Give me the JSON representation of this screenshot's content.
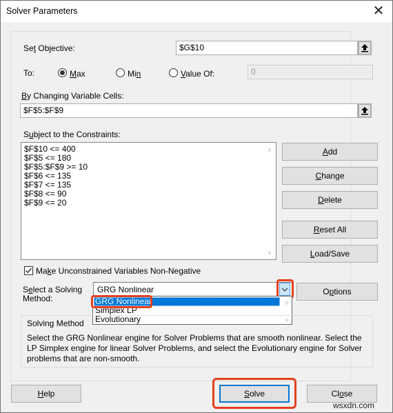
{
  "window": {
    "title": "Solver Parameters",
    "close_icon": "close-icon"
  },
  "objective": {
    "label_pre": "Se",
    "label_ul": "t",
    "label_post": " Objective:",
    "value": "$G$10"
  },
  "to": {
    "label": "To:",
    "options": [
      {
        "pre": "",
        "ul": "M",
        "post": "ax",
        "checked": true
      },
      {
        "pre": "Mi",
        "ul": "n",
        "post": "",
        "checked": false
      },
      {
        "pre": "",
        "ul": "V",
        "post": "alue Of:",
        "checked": false
      }
    ],
    "value_of": "0"
  },
  "changing_cells": {
    "label_ul": "B",
    "label_post": "y Changing Variable Cells:",
    "value": "$F$5:$F$9"
  },
  "constraints": {
    "label_pre": "S",
    "label_ul": "u",
    "label_post": "bject to the Constraints:",
    "items": [
      "$F$10 <= 400",
      "$F$5 <= 180",
      "$F$5:$F$9 >= 10",
      "$F$6 <= 135",
      "$F$7 <= 135",
      "$F$8 <= 90",
      "$F$9 <= 20"
    ]
  },
  "side_buttons": [
    {
      "ul": "A",
      "post": "dd"
    },
    {
      "ul": "C",
      "post": "hange"
    },
    {
      "ul": "D",
      "post": "elete"
    },
    {
      "ul": "R",
      "post": "eset All"
    },
    {
      "ul": "L",
      "post": "oad/Save"
    }
  ],
  "nonneg": {
    "checked": true,
    "label_pre": "Ma",
    "label_ul": "k",
    "label_post": "e Unconstrained Variables Non-Negative"
  },
  "method": {
    "label1_pre": "S",
    "label1_ul": "e",
    "label1_post": "lect a Solving",
    "label2": "Method:",
    "selected": "GRG Nonlinear",
    "options": [
      "GRG Nonlinear",
      "Simplex LP",
      "Evolutionary"
    ],
    "options_button_pre": "O",
    "options_button_ul": "p",
    "options_button_post": "tions"
  },
  "solving_method_group": {
    "title": "Solving Method",
    "description": "Select the GRG Nonlinear engine for Solver Problems that are smooth nonlinear. Select the LP Simplex engine for linear Solver Problems, and select the Evolutionary engine for Solver problems that are non-smooth."
  },
  "footer": {
    "help": {
      "ul": "H",
      "post": "elp"
    },
    "solve": {
      "ul": "S",
      "post": "olve"
    },
    "close": {
      "pre": "Cl",
      "ul": "o",
      "post": "se"
    }
  },
  "watermark": "wsxdn.com",
  "colors": {
    "highlight": "#e5401c",
    "selection": "#0078d7"
  }
}
